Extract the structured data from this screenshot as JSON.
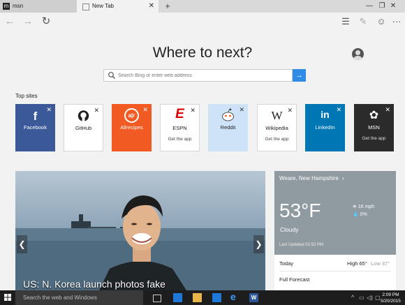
{
  "tabs": [
    {
      "label": "msn",
      "active": false
    },
    {
      "label": "New Tab",
      "active": true
    }
  ],
  "window_controls": {
    "minimize": "—",
    "maximize": "❐",
    "close": "✕"
  },
  "nav": {
    "back_icon": "back-arrow-icon",
    "forward_icon": "forward-arrow-icon",
    "refresh_icon": "refresh-icon"
  },
  "toolbar": {
    "hub_icon": "hub-icon",
    "note_icon": "web-note-icon",
    "feedback_icon": "smiley-icon",
    "more": "···"
  },
  "hero": {
    "title": "Where to next?"
  },
  "search": {
    "placeholder": "Search Bing or enter web address",
    "go_label": "→"
  },
  "top_sites": {
    "heading": "Top sites",
    "tiles": [
      {
        "name": "Facebook",
        "glyph": "f",
        "bg": "#3b5998",
        "sub": ""
      },
      {
        "name": "GitHub",
        "glyph": "●",
        "bg": "#ffffff",
        "sub": ""
      },
      {
        "name": "Allrecipes",
        "glyph": "a|r",
        "bg": "#f15a22",
        "sub": ""
      },
      {
        "name": "ESPN",
        "glyph": "E",
        "bg": "#ffffff",
        "sub": "Get the app"
      },
      {
        "name": "Reddit",
        "glyph": "👽",
        "bg": "#cee3f8",
        "sub": ""
      },
      {
        "name": "Wikipedia",
        "glyph": "W",
        "bg": "#ffffff",
        "sub": "Get the app"
      },
      {
        "name": "LinkedIn",
        "glyph": "in",
        "bg": "#0077b5",
        "sub": ""
      },
      {
        "name": "MSN",
        "glyph": "✿",
        "bg": "#2b2b2b",
        "sub": "Get the app"
      }
    ]
  },
  "news": {
    "headline": "US: N. Korea launch photos fake"
  },
  "weather": {
    "location": "Weare, New Hampshire",
    "temp": "53°F",
    "condition": "Cloudy",
    "wind": "16 mph",
    "precip": "0%",
    "updated": "Last Updated 01:52 PM",
    "today": "Today",
    "high": "High 65°",
    "low": "Low 37°",
    "full_forecast": "Full Forecast"
  },
  "taskbar": {
    "search_placeholder": "Search the web and Windows",
    "time": "2:09 PM",
    "date": "5/20/2015"
  },
  "colors": {
    "accent": "#2e8be6",
    "taskbar": "#1d1d1d"
  }
}
